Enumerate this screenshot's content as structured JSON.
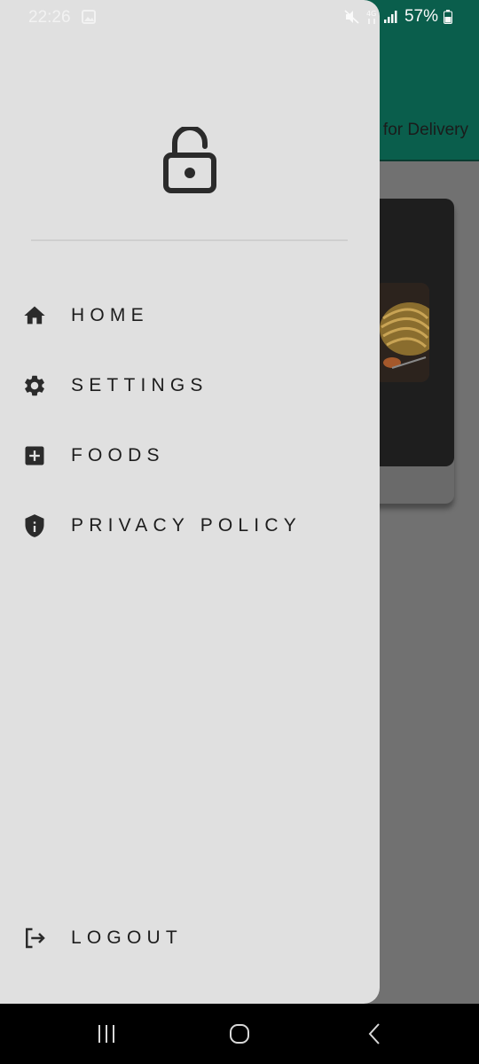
{
  "status_bar": {
    "time": "22:26",
    "battery": "57%",
    "icons": [
      "image-icon",
      "mute-icon",
      "4g-icon",
      "signal-icon",
      "battery-icon"
    ]
  },
  "background_app": {
    "header_text": "for Delivery",
    "header_color": "#0a5e4c"
  },
  "drawer": {
    "header_icon": "lock-open-icon",
    "items": [
      {
        "label": "HOME",
        "icon": "home-icon"
      },
      {
        "label": "SETTINGS",
        "icon": "gear-icon"
      },
      {
        "label": "FOODS",
        "icon": "add-box-icon"
      },
      {
        "label": "PRIVACY POLICY",
        "icon": "shield-info-icon"
      }
    ],
    "logout": {
      "label": "LOGOUT",
      "icon": "logout-icon"
    }
  },
  "system_nav": {
    "buttons": [
      "recents-button",
      "home-button",
      "back-button"
    ]
  }
}
